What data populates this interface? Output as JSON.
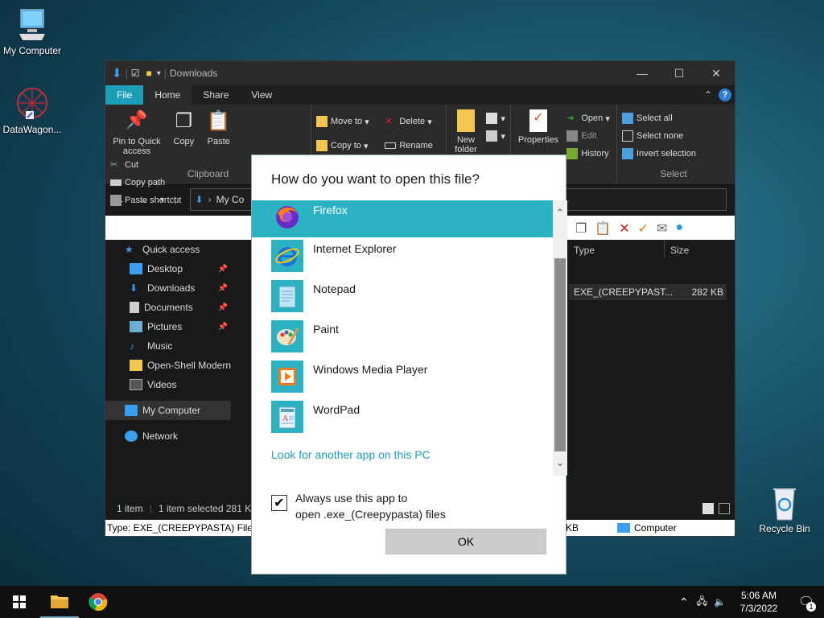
{
  "desktop": {
    "icons": [
      {
        "label": "My Computer"
      },
      {
        "label": "DataWagon..."
      },
      {
        "label": "Recycle Bin"
      }
    ]
  },
  "explorer": {
    "title": "Downloads",
    "tabs": [
      "File",
      "Home",
      "Share",
      "View"
    ],
    "clipboard": {
      "pin_label": "Pin to Quick access",
      "copy": "Copy",
      "paste": "Paste",
      "cut": "Cut",
      "copy_path": "Copy path",
      "paste_shortcut": "Paste shortcut",
      "group": "Clipboard"
    },
    "organize": {
      "move_to": "Move to",
      "copy_to": "Copy to",
      "delete": "Delete",
      "rename": "Rename"
    },
    "new": {
      "new_folder": "New folder"
    },
    "open": {
      "properties": "Properties",
      "open": "Open",
      "edit": "Edit",
      "history": "History",
      "group": "Open"
    },
    "select": {
      "select_all": "Select all",
      "select_none": "Select none",
      "invert": "Invert selection",
      "group": "Select"
    },
    "address": "My Co",
    "sidebar": [
      {
        "label": "Quick access",
        "pinned": false
      },
      {
        "label": "Desktop",
        "pinned": true
      },
      {
        "label": "Downloads",
        "pinned": true
      },
      {
        "label": "Documents",
        "pinned": true
      },
      {
        "label": "Pictures",
        "pinned": true
      },
      {
        "label": "Music",
        "pinned": false
      },
      {
        "label": "Open-Shell Modern",
        "pinned": false
      },
      {
        "label": "Videos",
        "pinned": false
      },
      {
        "label": "My Computer",
        "pinned": false
      },
      {
        "label": "Network",
        "pinned": false
      }
    ],
    "columns": {
      "type": "Type",
      "size": "Size"
    },
    "file": {
      "type": "EXE_(CREEPYPAST...",
      "size": "282 KB"
    },
    "status": {
      "count": "1 item",
      "selected": "1 item selected  281 K"
    },
    "infobar": {
      "text": "Type: EXE_(CREEPYPASTA) File, Size",
      "right_size": "KB",
      "location": "Computer"
    }
  },
  "dialog": {
    "title": "How do you want to open this file?",
    "apps": [
      {
        "name": "Firefox",
        "selected": true
      },
      {
        "name": "Internet Explorer",
        "selected": false
      },
      {
        "name": "Notepad",
        "selected": false
      },
      {
        "name": "Paint",
        "selected": false
      },
      {
        "name": "Windows Media Player",
        "selected": false
      },
      {
        "name": "WordPad",
        "selected": false
      }
    ],
    "look_more": "Look for another app on this PC",
    "always_line1": "Always use this app to",
    "always_line2": "open .exe_(Creepypasta) files",
    "always_checked": true,
    "ok": "OK"
  },
  "taskbar": {
    "time": "5:06 AM",
    "date": "7/3/2022",
    "notification_count": "1"
  },
  "colors": {
    "accent": "#1a9fb7",
    "selected_app": "#2bb3c4"
  }
}
